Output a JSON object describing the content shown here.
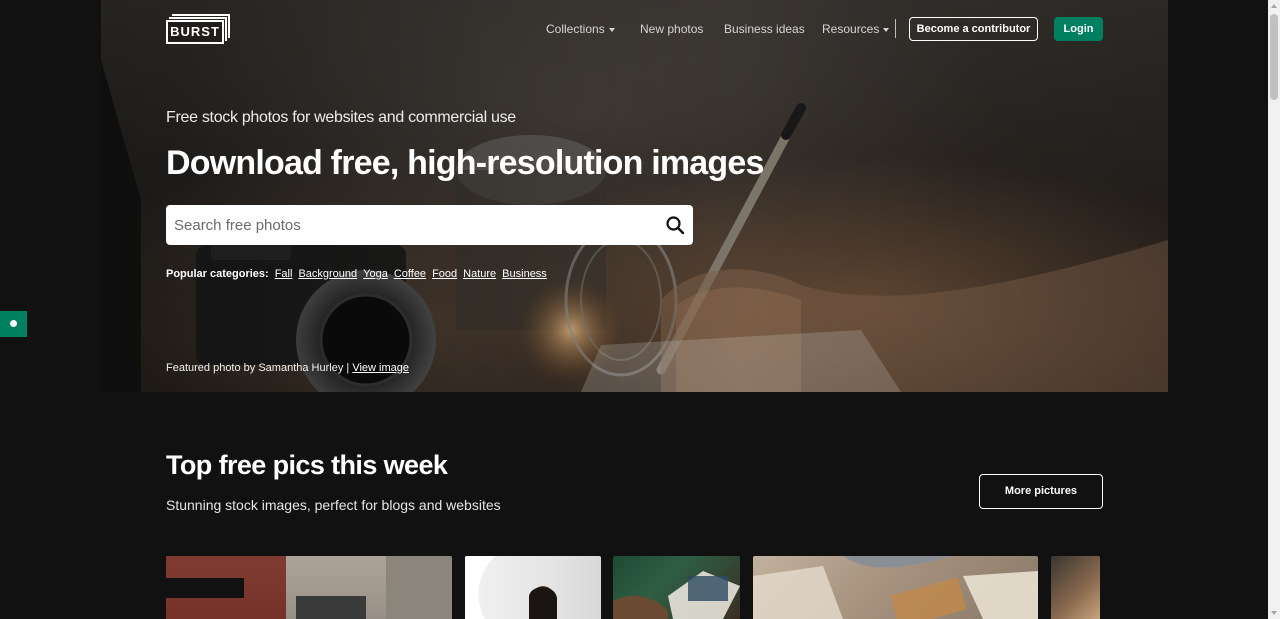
{
  "brand": {
    "logo_text": "BURST"
  },
  "nav": {
    "items": [
      {
        "label": "Collections",
        "has_dropdown": true
      },
      {
        "label": "New photos",
        "has_dropdown": false
      },
      {
        "label": "Business ideas",
        "has_dropdown": false
      },
      {
        "label": "Resources",
        "has_dropdown": true
      }
    ],
    "contributor_label": "Become a contributor",
    "login_label": "Login"
  },
  "hero": {
    "tagline": "Free stock photos for websites and commercial use",
    "headline": "Download free, high-resolution images",
    "search_placeholder": "Search free photos",
    "popular_label": "Popular categories:",
    "categories": [
      "Fall",
      "Background",
      "Yoga",
      "Coffee",
      "Food",
      "Nature",
      "Business"
    ],
    "featured_prefix": "Featured photo by Samantha Hurley |",
    "featured_link": "View image"
  },
  "section": {
    "title": "Top free pics this week",
    "subtitle": "Stunning stock images, perfect for blogs and websites",
    "more_label": "More pictures"
  },
  "colors": {
    "background": "#111111",
    "accent_green": "#008060",
    "text_white": "#ffffff"
  },
  "icons": [
    "search-icon",
    "chevron-down-icon",
    "feedback-icon"
  ]
}
